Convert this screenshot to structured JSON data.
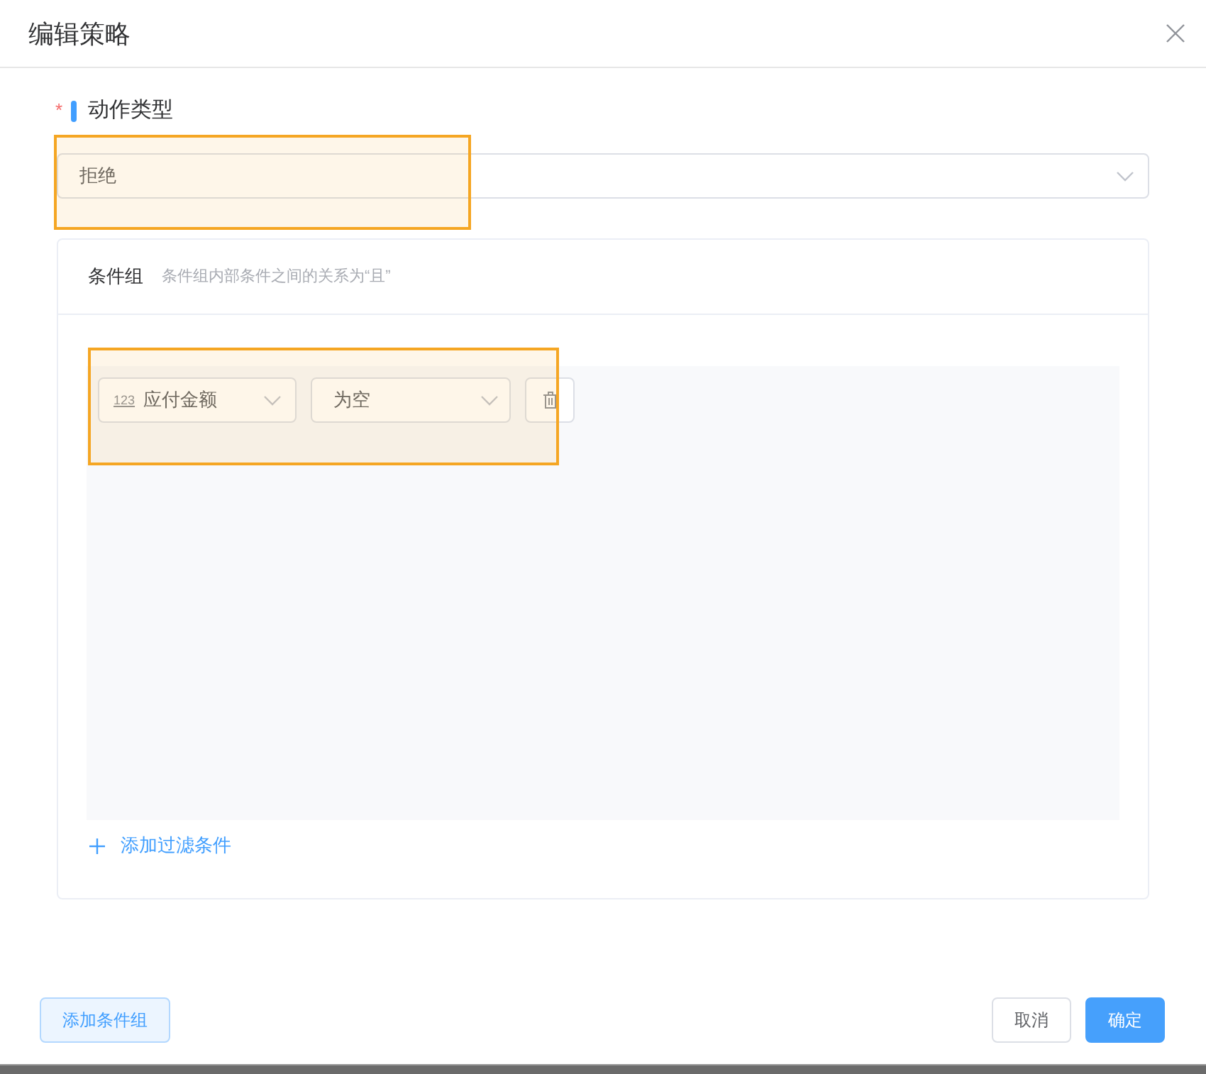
{
  "dialog": {
    "title": "编辑策略"
  },
  "action_type": {
    "required_mark": "*",
    "label": "动作类型",
    "value": "拒绝"
  },
  "condition_group": {
    "title": "条件组",
    "hint": "条件组内部条件之间的关系为“且”",
    "conditions": [
      {
        "field_type": "123",
        "field": "应付金额",
        "operator": "为空"
      }
    ],
    "add_filter": "添加过滤条件"
  },
  "footer": {
    "add_group": "添加条件组",
    "cancel": "取消",
    "confirm": "确定"
  }
}
